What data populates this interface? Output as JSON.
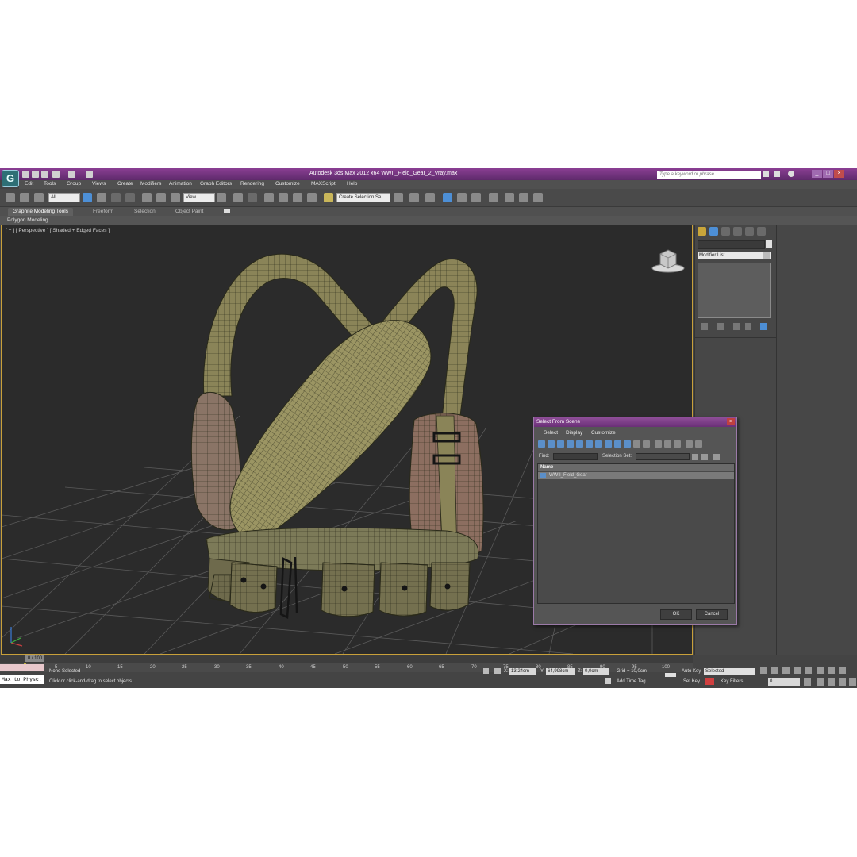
{
  "window": {
    "title": "Autodesk 3ds Max  2012 x64     WWII_Field_Gear_2_Vray.max",
    "search_placeholder": "Type a keyword or phrase"
  },
  "menu": [
    "Edit",
    "Tools",
    "Group",
    "Views",
    "Create",
    "Modifiers",
    "Animation",
    "Graph Editors",
    "Rendering",
    "Customize",
    "MAXScript",
    "Help"
  ],
  "toolbar": {
    "filter_value": "All",
    "coord_system": "View",
    "selection_set": "Create Selection Se"
  },
  "ribbon": {
    "tabs": [
      "Graphite Modeling Tools",
      "Freeform",
      "Selection",
      "Object Paint"
    ],
    "active_tab": "Graphite Modeling Tools",
    "subpanel": "Polygon Modeling"
  },
  "viewport": {
    "label": "[ + ] [ Perspective ] [ Shaded + Edged Faces ]"
  },
  "command_panel": {
    "modifier_list": "Modifier List"
  },
  "dialog": {
    "title": "Select From Scene",
    "menus": [
      "Select",
      "Display",
      "Customize"
    ],
    "find_label": "Find:",
    "selection_set_label": "Selection Set:",
    "column_name": "Name",
    "rows": [
      "WWII_Field_Gear"
    ],
    "ok_label": "OK",
    "cancel_label": "Cancel"
  },
  "timeline": {
    "frame_display": "0 / 100",
    "ticks": [
      "0",
      "5",
      "10",
      "15",
      "20",
      "25",
      "30",
      "35",
      "40",
      "45",
      "50",
      "55",
      "60",
      "65",
      "70",
      "75",
      "80",
      "85",
      "90",
      "95",
      "100"
    ]
  },
  "status": {
    "maxscript": "Max to Physc.",
    "selection": "None Selected",
    "prompt": "Click or click-and-drag to select objects",
    "x_label": "X:",
    "x_value": "13,24cm",
    "y_label": "Y:",
    "y_value": "64,998cm",
    "z_label": "Z:",
    "z_value": "0,0cm",
    "grid": "Grid = 10,0cm",
    "add_time_tag": "Add Time Tag",
    "auto_key": "Auto Key",
    "set_key": "Set Key",
    "key_mode": "Selected",
    "key_filters": "Key Filters...",
    "current_frame": "0"
  }
}
